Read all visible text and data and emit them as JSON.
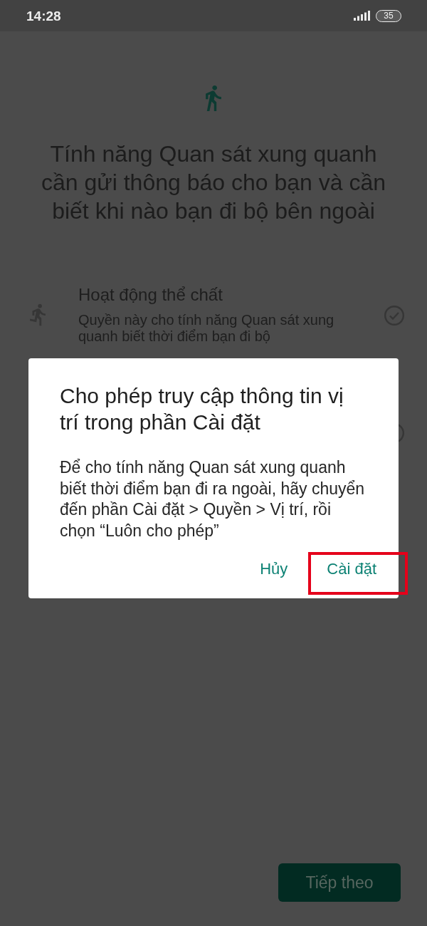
{
  "status_bar": {
    "time": "14:28",
    "battery": "35"
  },
  "header": {
    "title": "Tính năng Quan sát xung quanh cần gửi thông báo cho bạn và cần biết khi nào bạn đi bộ bên ngoài"
  },
  "permissions": [
    {
      "kind": "activity",
      "title": "Hoạt động thể chất",
      "description": "Quyền này cho tính năng Quan sát xung quanh biết thời điểm bạn đi bộ",
      "checked": true
    }
  ],
  "dialog": {
    "title": "Cho phép truy cập thông tin vị trí trong phần Cài đặt",
    "message": "Để cho tính năng Quan sát xung quanh biết thời điểm bạn đi ra ngoài, hãy chuyển đến phần Cài đặt > Quyền > Vị trí, rồi chọn “Luôn cho phép”",
    "buttons": [
      {
        "label": "Hủy",
        "highlighted": false
      },
      {
        "label": "Cài đặt",
        "highlighted": true
      }
    ]
  },
  "footer": {
    "next_button": {
      "label": "Tiếp theo",
      "disabled": true
    }
  }
}
